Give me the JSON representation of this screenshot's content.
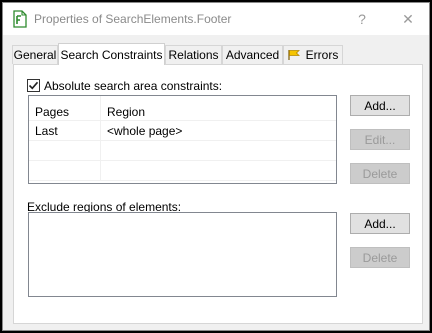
{
  "window": {
    "title": "Properties of SearchElements.Footer",
    "help_symbol": "?",
    "close_symbol": "✕"
  },
  "tabs": [
    {
      "label": "General"
    },
    {
      "label": "Search Constraints"
    },
    {
      "label": "Relations"
    },
    {
      "label": "Advanced"
    },
    {
      "label": "Errors"
    }
  ],
  "search_constraints": {
    "checkbox_label": "Absolute search area constraints:",
    "checkbox_checked": true,
    "columns": [
      "Pages",
      "Region"
    ],
    "rows": [
      {
        "pages": "Last",
        "region": "<whole page>"
      }
    ],
    "buttons": {
      "add": "Add...",
      "edit": "Edit...",
      "delete": "Delete"
    }
  },
  "exclude": {
    "label": "Exclude regions of elements:",
    "buttons": {
      "add": "Add...",
      "delete": "Delete"
    }
  },
  "colors": {
    "tab_flag": "#e8a800",
    "icon_green": "#2e8b2e"
  }
}
